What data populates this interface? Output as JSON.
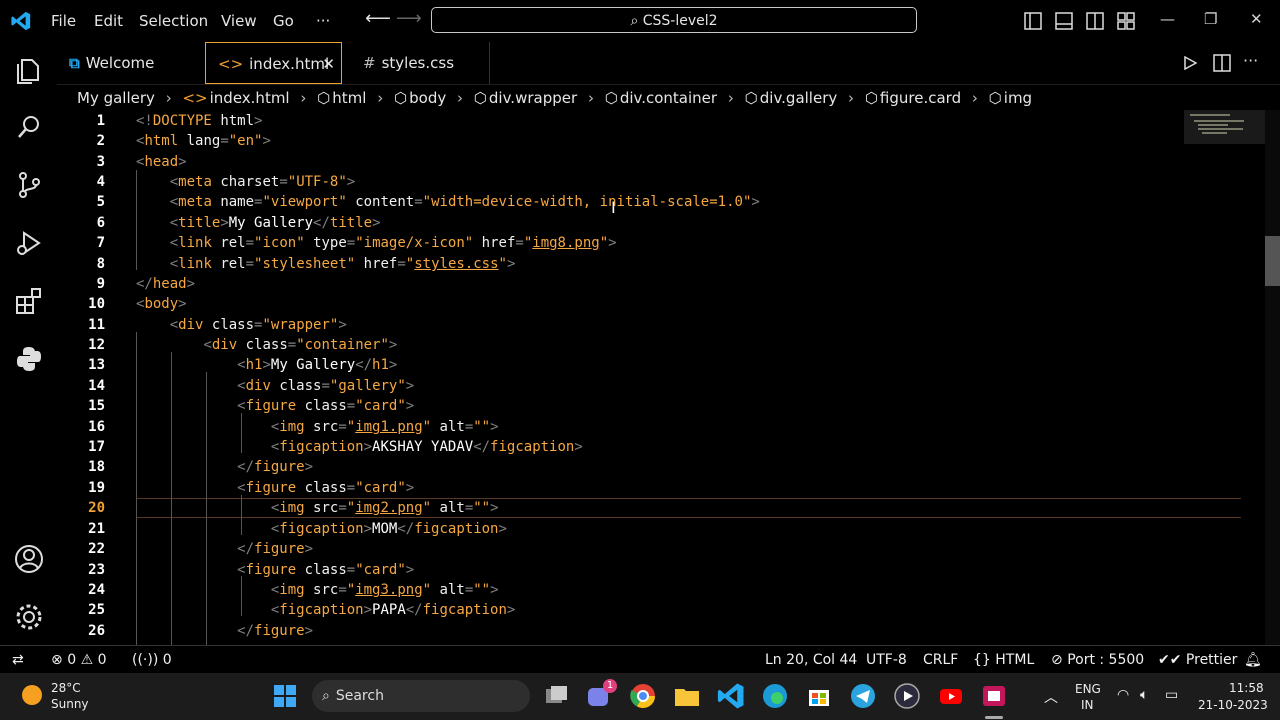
{
  "menu": [
    "File",
    "Edit",
    "Selection",
    "View",
    "Go",
    "···"
  ],
  "search": {
    "label": "CSS-level2"
  },
  "tabs": [
    {
      "label": "Welcome",
      "icon": "vscode-icon"
    },
    {
      "label": "index.html",
      "icon": "html-icon",
      "active": true
    },
    {
      "label": "styles.css",
      "icon": "css-hash-icon"
    }
  ],
  "breadcrumb": [
    "My gallery",
    "index.html",
    "html",
    "body",
    "div.wrapper",
    "div.container",
    "div.gallery",
    "figure.card",
    "img"
  ],
  "editor": {
    "current_line": 20,
    "lines": [
      {
        "n": "1"
      },
      {
        "n": "2"
      },
      {
        "n": "3"
      },
      {
        "n": "4"
      },
      {
        "n": "5"
      },
      {
        "n": "6"
      },
      {
        "n": "7"
      },
      {
        "n": "8"
      },
      {
        "n": "9"
      },
      {
        "n": "10"
      },
      {
        "n": "11"
      },
      {
        "n": "12"
      },
      {
        "n": "13"
      },
      {
        "n": "14"
      },
      {
        "n": "15"
      },
      {
        "n": "16"
      },
      {
        "n": "17"
      },
      {
        "n": "18"
      },
      {
        "n": "19"
      },
      {
        "n": "20"
      },
      {
        "n": "21"
      },
      {
        "n": "22"
      },
      {
        "n": "23"
      },
      {
        "n": "24"
      },
      {
        "n": "25"
      },
      {
        "n": "26"
      }
    ]
  },
  "status": {
    "errors": "0",
    "warnings": "0",
    "ports": "0",
    "position": "Ln 20, Col 44",
    "encoding": "UTF-8",
    "eol": "CRLF",
    "language": "HTML",
    "live_server": "Port : 5500",
    "formatter": "Prettier"
  },
  "taskbar": {
    "temp": "28°C",
    "condition": "Sunny",
    "search": "Search",
    "lang": "ENG",
    "region": "IN",
    "time": "11:58",
    "date": "21-10-2023",
    "teams_badge": "1"
  },
  "colors": {
    "accent": "#f0a030",
    "tag": "#f5a742",
    "background": "#000000",
    "vscode_blue": "#23a9f2"
  }
}
